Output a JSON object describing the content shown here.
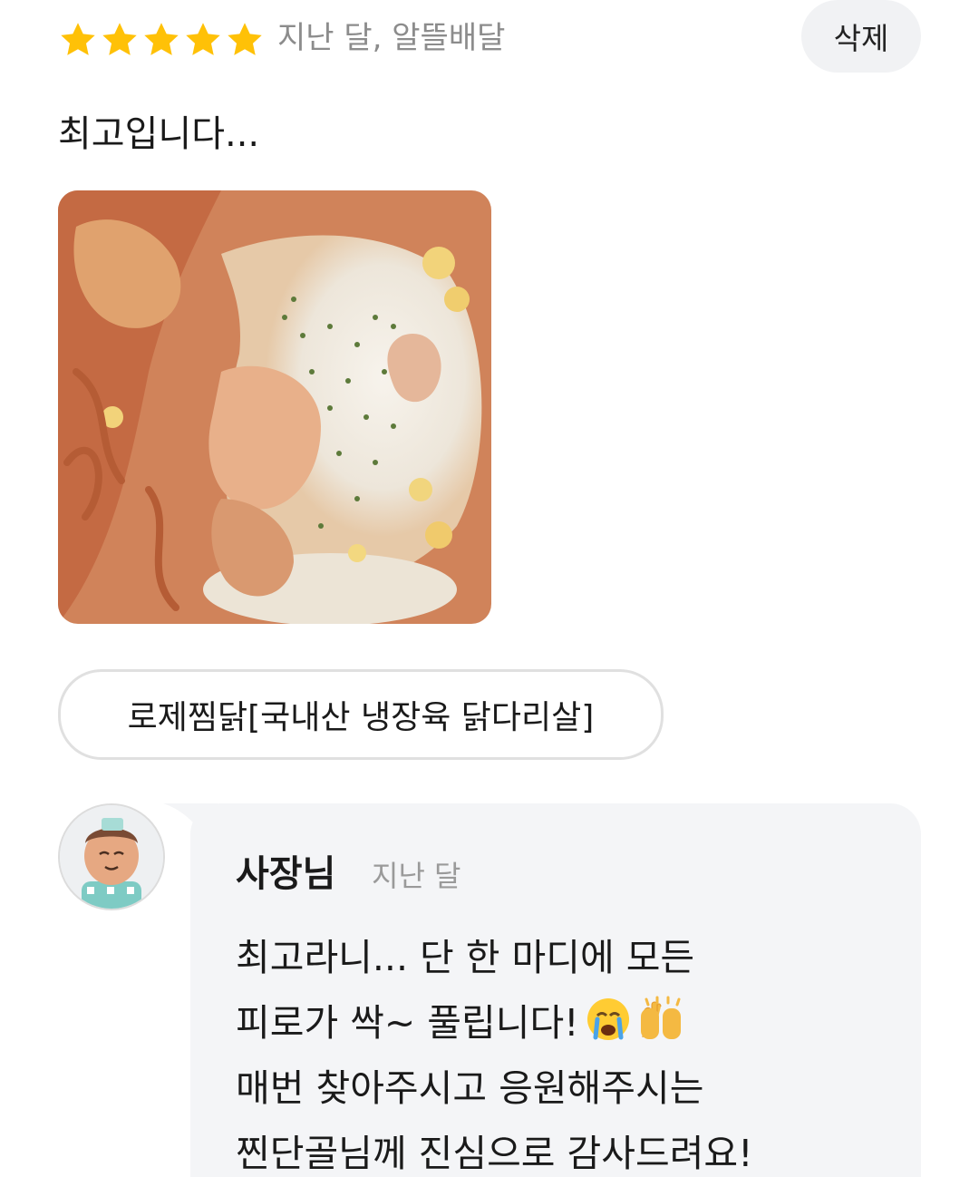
{
  "review": {
    "rating": 5,
    "rating_max": 5,
    "meta": "지난 달, 알뜰배달",
    "delete_label": "삭제",
    "text": "최고입니다...",
    "photo_icon": "food-photo",
    "menu_item": "로제찜닭[국내산 냉장육 닭다리살]"
  },
  "reply": {
    "author": "사장님",
    "time": "지난 달",
    "lines": [
      "최고라니... 단 한 마디에 모든",
      "피로가 싹~ 풀립니다!",
      "매번 찾아주시고 응원해주시는",
      "찐단골님께 진심으로 감사드려요!"
    ],
    "emojis": [
      "crying-face-icon",
      "raising-hands-icon"
    ]
  },
  "colors": {
    "star": "#ffc107",
    "meta_text": "#8c8c8c",
    "bubble": "#f4f5f7",
    "chip_border": "#e0e0e0"
  }
}
